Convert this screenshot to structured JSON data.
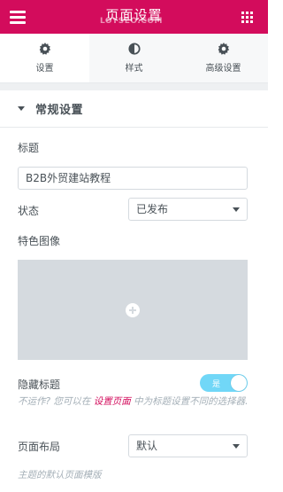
{
  "header": {
    "title": "页面设置",
    "watermark": "LOYSEO.COM"
  },
  "tabs": [
    {
      "label": "设置",
      "icon": "gear-icon",
      "active": true
    },
    {
      "label": "样式",
      "icon": "half-circle-icon",
      "active": false
    },
    {
      "label": "高级设置",
      "icon": "gear-icon",
      "active": false
    }
  ],
  "section": {
    "title": "常规设置"
  },
  "fields": {
    "title_label": "标题",
    "title_value": "B2B外贸建站教程",
    "status_label": "状态",
    "status_value": "已发布",
    "featured_image_label": "特色图像",
    "hide_title_label": "隐藏标题",
    "hide_title_toggle": "是",
    "hide_title_on": true,
    "hide_title_desc_before": "不运作? 您可以在 ",
    "hide_title_desc_link": "设置页面",
    "hide_title_desc_after": " 中为标题设置不同的选择器.",
    "layout_label": "页面布局",
    "layout_value": "默认",
    "layout_desc": "主题的默认页面模版"
  },
  "colors": {
    "accent": "#d30c5c",
    "toggle_on": "#71d7f7",
    "placeholder_bg": "#d5dadf"
  }
}
